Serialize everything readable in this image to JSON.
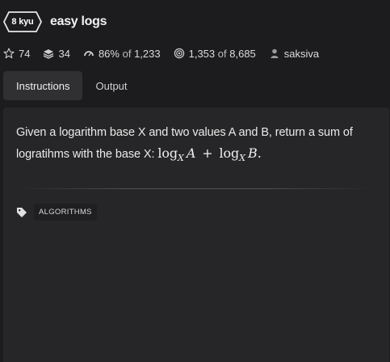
{
  "kata": {
    "rank": "8 kyu",
    "title": "easy logs"
  },
  "stats": {
    "stars": "74",
    "collections": "34",
    "satisfaction_pct": "86%",
    "satisfaction_of": "of",
    "satisfaction_total": "1,233",
    "completed": "1,353",
    "completed_of": "of",
    "completed_total": "8,685",
    "author": "saksiva"
  },
  "tabs": [
    {
      "label": "Instructions",
      "active": true
    },
    {
      "label": "Output",
      "active": false
    }
  ],
  "description": {
    "text": "Given a logarithm base X and two values A and B, return a sum of logratihms with the base X:",
    "formula_log1": "log",
    "formula_sub1": "X",
    "formula_var1": "A",
    "formula_plus": "+",
    "formula_log2": "log",
    "formula_sub2": "X",
    "formula_var2": "B",
    "formula_end": "."
  },
  "tags": [
    "ALGORITHMS"
  ],
  "colors": {
    "background": "#1c1c1e",
    "panel": "#262628",
    "active_tab": "#303033",
    "badge_border": "#e6e6e6"
  },
  "icons": {
    "stars": "star-icon",
    "collections": "layers-icon",
    "satisfaction": "gauge-icon",
    "completed": "target-icon",
    "author": "user-icon",
    "tag": "tag-icon"
  }
}
